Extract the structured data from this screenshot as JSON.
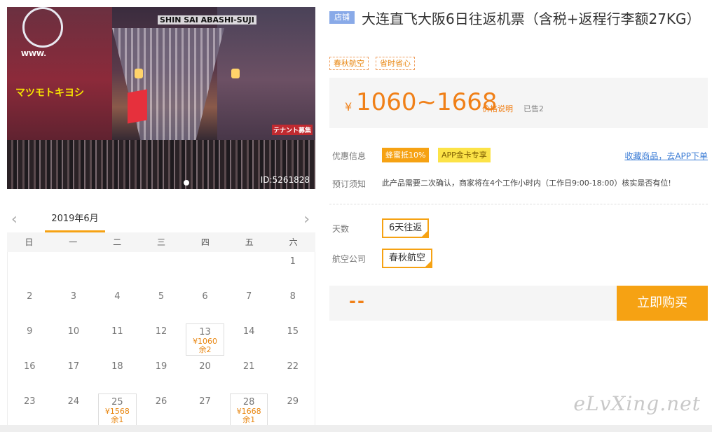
{
  "photo": {
    "sign_top": "SHIN SAI ABASHI-SUJI",
    "sign_yellow": "マツモトキヨシ",
    "sign_www": "WWW.",
    "sign_tenant": "テナント募集",
    "id_label": "ID:5261828"
  },
  "calendar": {
    "prev_icon": "‹",
    "next_icon": "›",
    "month": "2019年6月",
    "weekdays": [
      "日",
      "一",
      "二",
      "三",
      "四",
      "五",
      "六"
    ],
    "days": [
      {
        "day": ""
      },
      {
        "day": ""
      },
      {
        "day": ""
      },
      {
        "day": ""
      },
      {
        "day": ""
      },
      {
        "day": ""
      },
      {
        "day": "1"
      },
      {
        "day": "2"
      },
      {
        "day": "3"
      },
      {
        "day": "4"
      },
      {
        "day": "5"
      },
      {
        "day": "6"
      },
      {
        "day": "7"
      },
      {
        "day": "8"
      },
      {
        "day": "9"
      },
      {
        "day": "10"
      },
      {
        "day": "11"
      },
      {
        "day": "12"
      },
      {
        "day": "13",
        "price": "¥1060",
        "left": "余2"
      },
      {
        "day": "14"
      },
      {
        "day": "15"
      },
      {
        "day": "16"
      },
      {
        "day": "17"
      },
      {
        "day": "18"
      },
      {
        "day": "19"
      },
      {
        "day": "20"
      },
      {
        "day": "21"
      },
      {
        "day": "22"
      },
      {
        "day": "23"
      },
      {
        "day": "24"
      },
      {
        "day": "25",
        "price": "¥1568",
        "left": "余1"
      },
      {
        "day": "26"
      },
      {
        "day": "27"
      },
      {
        "day": "28",
        "price": "¥1668",
        "left": "余1"
      },
      {
        "day": "29"
      }
    ]
  },
  "product": {
    "store_tag": "店铺",
    "title": "大连直飞大阪6日往返机票（含税+返程行李额27KG）",
    "tags": [
      "春秋航空",
      "省时省心"
    ],
    "price_symbol": "¥",
    "price": "1060~1668",
    "price_desc": "价格说明",
    "sold": "已售2",
    "promo_label": "优惠信息",
    "promo_orange": "蜂蜜抵10%",
    "promo_yellow": "APP金卡专享",
    "fav_link": "收藏商品，去APP下单",
    "notice_label": "预订须知",
    "notice": "此产品需要二次确认，商家将在4个工作小时内（工作日9:00-18:00）核实是否有位!",
    "days_label": "天数",
    "days_option": "6天往返",
    "airline_label": "航空公司",
    "airline_option": "春秋航空",
    "total": "--",
    "buy_label": "立即购买"
  },
  "watermark": "eLvXing.net"
}
